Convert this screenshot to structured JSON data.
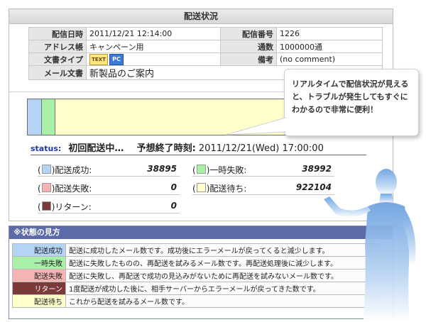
{
  "panel": {
    "title": "配送状況",
    "info": {
      "date_label": "配信日時",
      "date_value": "2011/12/21 12:14:00",
      "number_label": "配信番号",
      "number_value": "1226",
      "address_label": "アドレス帳",
      "address_value": "キャンペーン用",
      "count_label": "通数",
      "count_value": "1000000通",
      "doctype_label": "文書タイプ",
      "doctype_text_icon": "TEXT",
      "doctype_pc_icon": "PC",
      "remarks_label": "備考",
      "remarks_value": "(no comment)",
      "mail_label": "メール文書",
      "mail_value": "新製品のご案内"
    },
    "progress": [
      {
        "name": "配送成功",
        "count": 38895,
        "color": "#b3d4f5"
      },
      {
        "name": "一時失敗",
        "count": 38992,
        "color": "#a8f0a8"
      },
      {
        "name": "配送失敗",
        "count": 0,
        "color": "#f5b3b3"
      },
      {
        "name": "リターン",
        "count": 0,
        "color": "#7a3a3a"
      },
      {
        "name": "配送待ち",
        "count": 922104,
        "color": "#ffffcc"
      }
    ],
    "status": {
      "label": "status:",
      "value": "初回配送中…",
      "eta_label": "予想終了時刻:",
      "eta_value": "2011/12/21(Wed) 17:00:00"
    },
    "counts": {
      "paren_open": "(",
      "paren_close": ")",
      "success_label": "配送成功:",
      "success_value": "38895",
      "temp_label": "一時失敗:",
      "temp_value": "38992",
      "fail_label": "配送失敗:",
      "fail_value": "0",
      "wait_label": "配送待ち:",
      "wait_value": "922104",
      "return_label": "リターン:",
      "return_value": "0"
    }
  },
  "legend": {
    "title": "※状態の見方",
    "rows": [
      {
        "key": "配送成功",
        "desc": "配送に成功したメール数です。成功後にエラーメールが戻ってくると減少します。",
        "bg": "#b3d4f5",
        "fg": "#222222"
      },
      {
        "key": "一時失敗",
        "desc": "配送に失敗したものの、再配送を試みるメール数です。再配送処理後に減少します。",
        "bg": "#a8f0a8",
        "fg": "#222222"
      },
      {
        "key": "配送失敗",
        "desc": "配送に失敗し、再配送で成功の見込みがないために再配送を試みないメール数です。",
        "bg": "#f5b3b3",
        "fg": "#222222"
      },
      {
        "key": "リターン",
        "desc": "1度配送が成功した後に、相手サーバーからエラーメールが戻ってきた数です。",
        "bg": "#7a3a3a",
        "fg": "#ffffff"
      },
      {
        "key": "配送待ち",
        "desc": "これから配送を試みるメール数です。",
        "bg": "#ffffcc",
        "fg": "#222222"
      }
    ]
  },
  "bubble": {
    "text": "リアルタイムで配信状況が見えると、トラブルが発生してもすぐにわかるので非常に便利！"
  }
}
